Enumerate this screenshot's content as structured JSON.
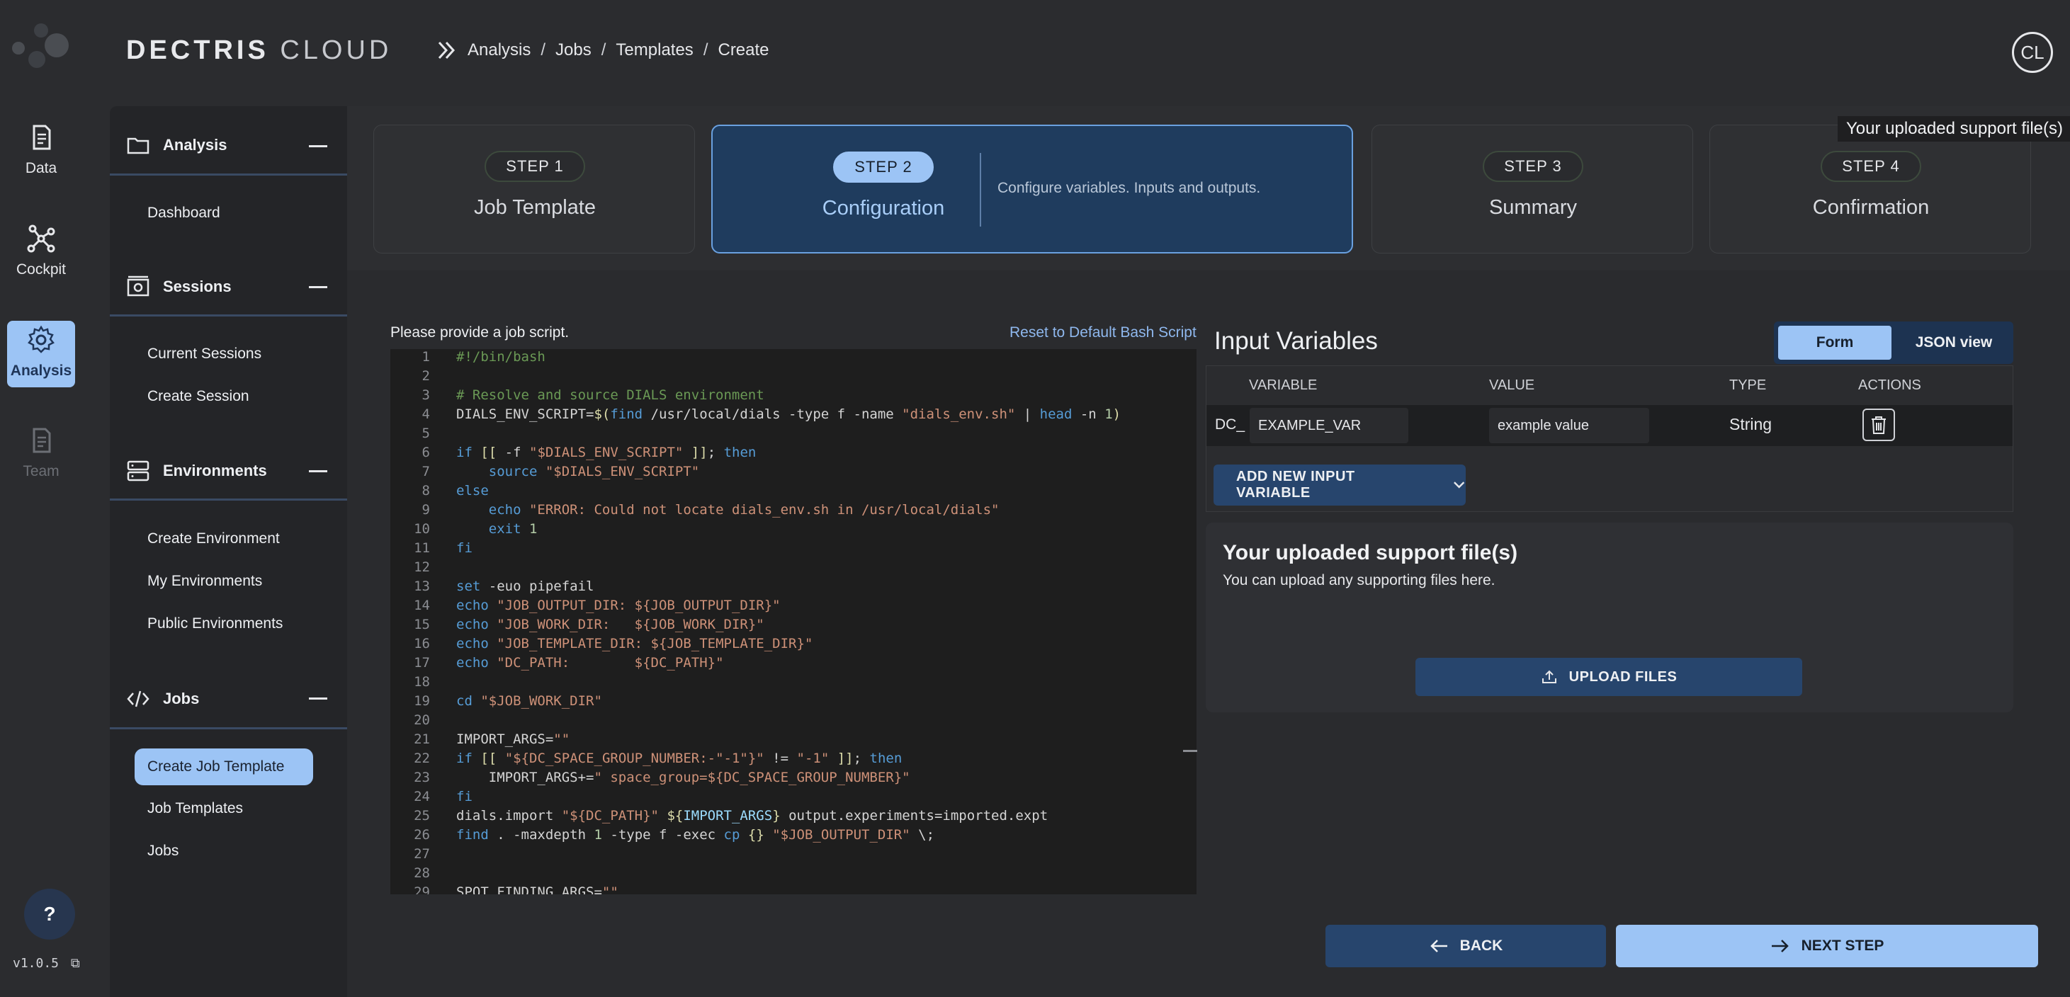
{
  "header": {
    "brand_bold": "DECTRIS",
    "brand_light": "CLOUD",
    "breadcrumbs": [
      "Analysis",
      "Jobs",
      "Templates",
      "Create"
    ],
    "avatar_initials": "CL",
    "tooltip": "Your uploaded support file(s)"
  },
  "rail": {
    "items": [
      {
        "label": "Data",
        "icon": "document-icon"
      },
      {
        "label": "Cockpit",
        "icon": "graph-icon"
      },
      {
        "label": "Analysis",
        "icon": "gear-icon",
        "active": true
      },
      {
        "label": "Team",
        "icon": "document-icon",
        "disabled": true
      }
    ],
    "help": "?",
    "version": "v1.0.5"
  },
  "sidebar": {
    "sections": [
      {
        "title": "Analysis",
        "icon": "folder-icon",
        "items": [
          "Dashboard"
        ]
      },
      {
        "title": "Sessions",
        "icon": "camera-icon",
        "items": [
          "Current Sessions",
          "Create Session"
        ]
      },
      {
        "title": "Environments",
        "icon": "server-icon",
        "items": [
          "Create Environment",
          "My Environments",
          "Public Environments"
        ]
      },
      {
        "title": "Jobs",
        "icon": "code-icon",
        "items": [
          "Create Job Template",
          "Job Templates",
          "Jobs"
        ],
        "active_item": "Create Job Template"
      }
    ]
  },
  "steps": [
    {
      "label": "STEP 1",
      "title": "Job Template"
    },
    {
      "label": "STEP 2",
      "title": "Configuration",
      "description": "Configure variables. Inputs and outputs.",
      "active": true
    },
    {
      "label": "STEP 3",
      "title": "Summary"
    },
    {
      "label": "STEP 4",
      "title": "Confirmation"
    }
  ],
  "editor": {
    "label": "Please provide a job script.",
    "reset_link": "Reset to Default Bash Script",
    "line_numbers": [
      "1",
      "2",
      "3",
      "4",
      "5",
      "6",
      "7",
      "8",
      "9",
      "10",
      "11",
      "12",
      "13",
      "14",
      "15",
      "16",
      "17",
      "18",
      "19",
      "20",
      "21",
      "22",
      "23",
      "24",
      "25",
      "26",
      "27",
      "28",
      "29"
    ]
  },
  "input_variables": {
    "title": "Input Variables",
    "toggle": {
      "form": "Form",
      "json": "JSON view"
    },
    "columns": [
      "VARIABLE",
      "VALUE",
      "TYPE",
      "ACTIONS"
    ],
    "rows": [
      {
        "prefix": "DC_",
        "variable": "EXAMPLE_VAR",
        "value": "example value",
        "type": "String"
      }
    ],
    "add_button": "ADD NEW INPUT VARIABLE"
  },
  "uploads": {
    "title": "Your uploaded support file(s)",
    "subtitle": "You can upload any supporting files here.",
    "button": "UPLOAD FILES"
  },
  "footer": {
    "back": "BACK",
    "next": "NEXT STEP"
  },
  "colors": {
    "accent": "#9cc4f5",
    "button_dark": "#27456d",
    "background": "#2b2c2f"
  }
}
